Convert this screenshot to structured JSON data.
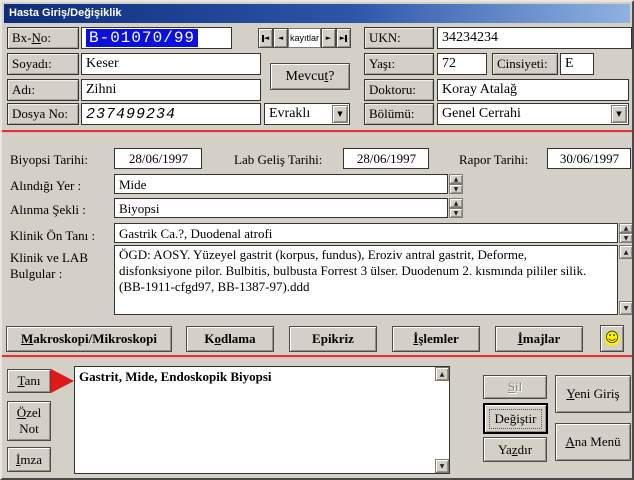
{
  "window": {
    "title": "Hasta Giriş/Değişiklik"
  },
  "colors": {
    "background": "#d4d0c8",
    "titlebar_left": "#0e2d7a",
    "titlebar_right": "#90b2e0",
    "selection_blue": "#0a10dd",
    "divider_red": "#dd3535",
    "smiley_yellow": "#ffee00",
    "arrow_red": "#e01818"
  },
  "icons": {
    "up": "▲",
    "down": "▼",
    "combo": "▼",
    "nav_prev": "◄",
    "nav_next": "►",
    "smiley": "☺"
  },
  "top": {
    "bx_no": {
      "label": {
        "pre": "Bx-",
        "hot": "N",
        "post": "o:"
      },
      "value": "B-01070/99"
    },
    "record_nav": {
      "label": "kayıtlar"
    },
    "ukn": {
      "label": "UKN:",
      "value": "34234234"
    },
    "soyadi": {
      "label": "Soyadı:",
      "value": "Keser"
    },
    "mevcut": {
      "label": {
        "pre": "Mevcu",
        "hot": "t",
        "post": "?"
      }
    },
    "yasi": {
      "label": "Yaşı:",
      "value": "72"
    },
    "cinsiyeti": {
      "label": "Cinsiyeti:",
      "value": "E"
    },
    "adi": {
      "label": "Adı:",
      "value": "Zihni"
    },
    "doktoru": {
      "label": "Doktoru:",
      "value": "Koray Atalağ"
    },
    "dosya_no": {
      "label": "Dosya No:",
      "value": "237499234"
    },
    "evrak": {
      "value": "Evraklı"
    },
    "bolumu": {
      "label": "Bölümü:",
      "value": "Genel Cerrahi"
    }
  },
  "middle": {
    "biyopsi_tarihi": {
      "label": "Biyopsi Tarihi:",
      "value": "28/06/1997"
    },
    "lab_gelis_tarihi": {
      "label": "Lab Geliş Tarihi:",
      "value": "28/06/1997"
    },
    "rapor_tarihi": {
      "label": "Rapor Tarihi:",
      "value": "30/06/1997"
    },
    "alindigi_yer": {
      "label": "Alındığı Yer :",
      "value": "Mide"
    },
    "alinma_sekli": {
      "label": "Alınma Şekli :",
      "value": "Biyopsi"
    },
    "klinik_on_tani": {
      "label": "Klinik Ön Tanı :",
      "value": "Gastrik Ca.?, Duodenal atrofi"
    },
    "klinik_lab": {
      "label_line1": "Klinik ve LAB",
      "label_line2": "Bulgular :",
      "value": "ÖGD: AOSY. Yüzeyel gastrit (korpus, fundus), Eroziv antral gastrit, Deforme, disfonksiyone pilor. Bulbitis, bulbusta Forrest 3 ülser. Duodenum 2. kısmında pililer silik. (BB-1911-cfgd97, BB-1387-97).ddd"
    }
  },
  "toolbar": {
    "makroskopi": {
      "pre": "",
      "hot": "M",
      "post": "akroskopi/Mikroskopi"
    },
    "kodlama": {
      "pre": "K",
      "hot": "o",
      "post": "dlama"
    },
    "epikriz": {
      "pre": "Epikriz",
      "hot": "",
      "post": ""
    },
    "islemler": {
      "pre": "",
      "hot": "İ",
      "post": "şlemler"
    },
    "imajlar": {
      "pre": "",
      "hot": "İ",
      "post": "majlar"
    }
  },
  "bottom": {
    "tani": {
      "pre": "",
      "hot": "T",
      "post": "anı"
    },
    "ozel_not": {
      "line1": {
        "pre": "",
        "hot": "Ö",
        "post": "zel"
      },
      "line2": "Not"
    },
    "imza": {
      "pre": "",
      "hot": "İ",
      "post": "mza"
    },
    "diagnosis": "Gastrit, Mide, Endoskopik Biyopsi",
    "sil": {
      "pre": "",
      "hot": "S",
      "post": "il"
    },
    "yeni_giris": {
      "pre": "",
      "hot": "Y",
      "post": "eni Giriş"
    },
    "degistir": {
      "pre": "De",
      "hot": "ğ",
      "post": "iştir"
    },
    "yazdir": {
      "pre": "Ya",
      "hot": "z",
      "post": "dır"
    },
    "ana_menu": {
      "pre": "",
      "hot": "A",
      "post": "na Menü"
    }
  }
}
